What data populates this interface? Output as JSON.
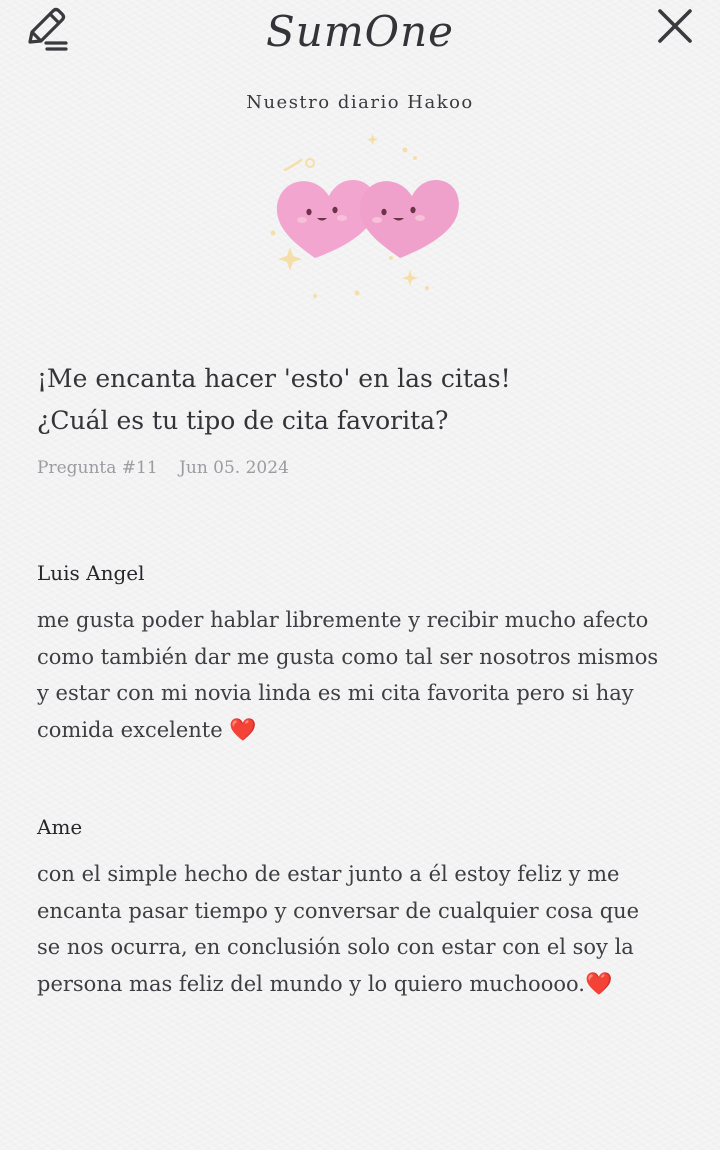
{
  "header": {
    "brand": "SumOne",
    "edit_icon": "pencil-write-icon",
    "close_icon": "close-x-icon"
  },
  "diary": {
    "title": "Nuestro diario Hakoo",
    "illustration": "two-smiling-hearts-icon"
  },
  "question": {
    "lines": [
      "¡Me encanta hacer 'esto' en las citas!",
      "¿Cuál es tu tipo de cita favorita?"
    ],
    "number": "Pregunta #11",
    "date": "Jun 05. 2024"
  },
  "answers": [
    {
      "name": "Luis Angel",
      "lines": [
        "me gusta poder hablar libremente y recibir mucho afecto",
        "como también dar me gusta como tal ser nosotros mismos",
        "y estar con mi novia linda es mi cita favorita pero si hay",
        "comida excelente"
      ],
      "trailing_emoji": "❤️"
    },
    {
      "name": "Ame",
      "lines": [
        "con el simple hecho de estar junto a él estoy feliz y me",
        "encanta pasar tiempo y conversar de cualquier cosa que",
        "se nos ocurra, en conclusión solo con estar con el soy la",
        "persona mas feliz del mundo y lo quiero muchoooo."
      ],
      "trailing_emoji": "❤️"
    }
  ],
  "colors": {
    "background": "#f3f3f4",
    "text": "#343438",
    "meta": "#9b9ba0",
    "heart_pink": "#f2a5cf",
    "heart_emoji": "#e8202a"
  }
}
